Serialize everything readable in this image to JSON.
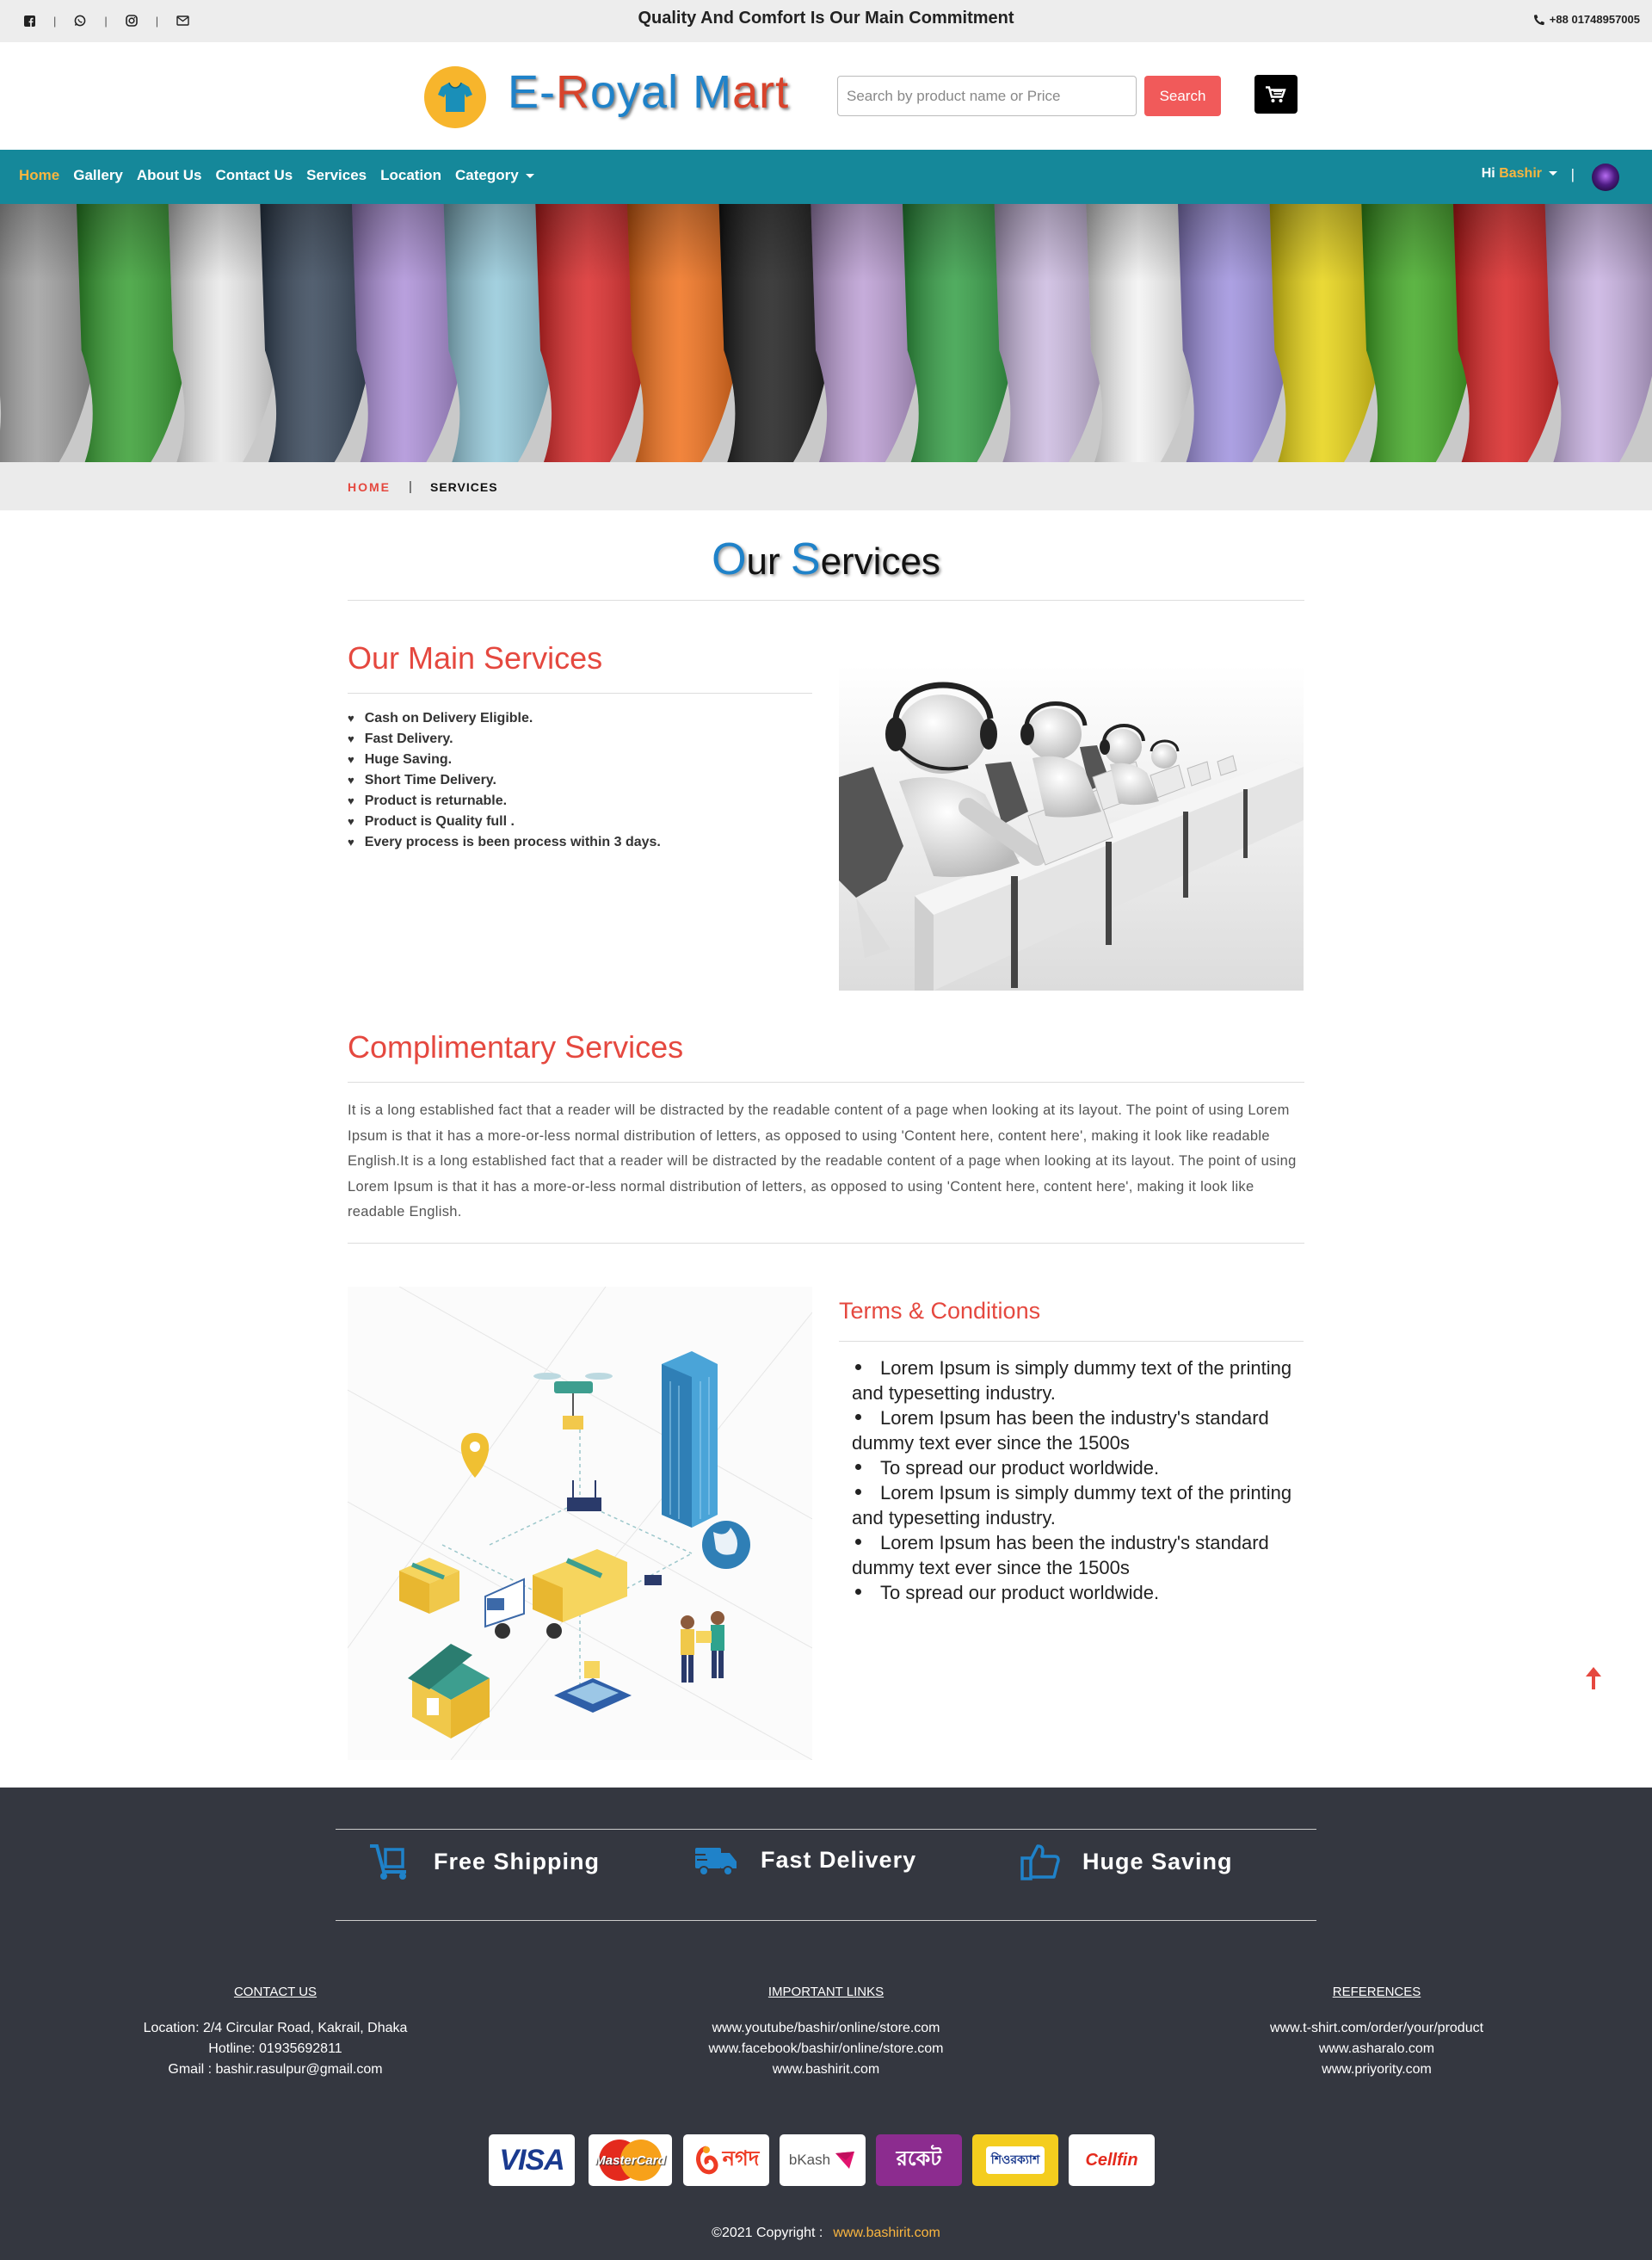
{
  "topbar": {
    "tagline": "Quality And Comfort Is Our Main Commitment",
    "phone": "+88 01748957005",
    "social_icons": [
      "facebook-icon",
      "whatsapp-icon",
      "instagram-icon",
      "mail-icon"
    ]
  },
  "header": {
    "brand_prefix": "E-",
    "brand_r": "R",
    "brand_oyal": "oyal ",
    "brand_m": "M",
    "brand_art": "art",
    "search_placeholder": "Search by product name or Price",
    "search_button": "Search"
  },
  "nav": {
    "items": [
      "Home",
      "Gallery",
      "About Us",
      "Contact Us",
      "Services",
      "Location",
      "Category"
    ],
    "greeting": "Hi",
    "username": "Bashir",
    "separator": "|"
  },
  "breadcrumb": {
    "home": "HOME",
    "separator": "|",
    "current": "SERVICES"
  },
  "page": {
    "title_o": "O",
    "title_ur": "ur ",
    "title_s": "S",
    "title_ervices": "ervices"
  },
  "main_services": {
    "heading": "Our Main Services",
    "items": [
      "Cash on Delivery Eligible.",
      "Fast Delivery.",
      "Huge Saving.",
      "Short Time Delivery.",
      "Product is returnable.",
      "Product is Quality full .",
      "Every process is been process within 3 days."
    ]
  },
  "complimentary": {
    "heading": "Complimentary Services",
    "text": "It is a long established fact that a reader will be distracted by the readable content of a page when looking at its layout. The point of using Lorem Ipsum is that it has a more-or-less normal distribution of letters, as opposed to using 'Content here, content here', making it look like readable English.It is a long established fact that a reader will be distracted by the readable content of a page when looking at its layout. The point of using Lorem Ipsum is that it has a more-or-less normal distribution of letters, as opposed to using 'Content here, content here', making it look like readable English."
  },
  "terms": {
    "heading": "Terms & Conditions",
    "items": [
      "Lorem Ipsum is simply dummy text of the printing and typesetting industry.",
      "Lorem Ipsum has been the industry's standard dummy text ever since the 1500s",
      "To spread our product worldwide.",
      "Lorem Ipsum is simply dummy text of the printing and typesetting industry.",
      "Lorem Ipsum has been the industry's standard dummy text ever since the 1500s",
      "To spread our product worldwide."
    ]
  },
  "features": [
    "Free Shipping",
    "Fast Delivery",
    "Huge Saving"
  ],
  "footer": {
    "contact": {
      "title": "CONTACT US",
      "location": "Location: 2/4 Circular Road, Kakrail, Dhaka",
      "hotline": "Hotline: 01935692811",
      "gmail": "Gmail : bashir.rasulpur@gmail.com"
    },
    "links": {
      "title": "IMPORTANT LINKS",
      "items": [
        "www.youtube/bashir/online/store.com",
        "www.facebook/bashir/online/store.com",
        "www.bashirit.com"
      ]
    },
    "references": {
      "title": "REFERENCES",
      "items": [
        "www.t-shirt.com/order/your/product",
        "www.asharalo.com",
        "www.priyority.com"
      ]
    },
    "payments": [
      "VISA",
      "MasterCard",
      "নগদ",
      "bKash",
      "রকেট",
      "শিওরক্যাশ",
      "Cellfin"
    ],
    "copyright": "©2021 Copyright :",
    "copyright_link": "www.bashirit.com"
  },
  "colors": {
    "nav_bg": "#15889a",
    "accent_red": "#e5483f",
    "accent_yellow": "#f9b53f",
    "brand_blue": "#1f82c9",
    "footer_bg": "#343740"
  }
}
